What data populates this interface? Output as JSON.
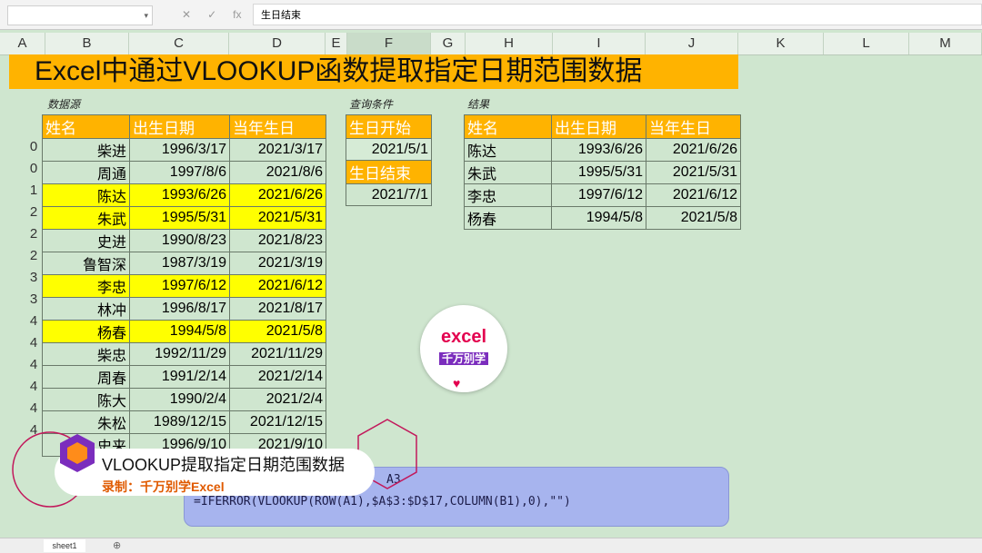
{
  "formula_bar": {
    "name_box": "",
    "fx": "fx",
    "value": "生日结束"
  },
  "columns": [
    "A",
    "B",
    "C",
    "D",
    "E",
    "F",
    "G",
    "H",
    "I",
    "J",
    "K",
    "L",
    "M"
  ],
  "title": "Excel中通过VLOOKUP函数提取指定日期范围数据",
  "source": {
    "label": "数据源",
    "headers": [
      "姓名",
      "出生日期",
      "当年生日"
    ],
    "rows": [
      {
        "a": "0",
        "name": "柴进",
        "birth": "1996/3/17",
        "bday": "2021/3/17"
      },
      {
        "a": "0",
        "name": "周通",
        "birth": "1997/8/6",
        "bday": "2021/8/6"
      },
      {
        "a": "1",
        "name": "陈达",
        "birth": "1993/6/26",
        "bday": "2021/6/26"
      },
      {
        "a": "2",
        "name": "朱武",
        "birth": "1995/5/31",
        "bday": "2021/5/31"
      },
      {
        "a": "2",
        "name": "史进",
        "birth": "1990/8/23",
        "bday": "2021/8/23"
      },
      {
        "a": "2",
        "name": "鲁智深",
        "birth": "1987/3/19",
        "bday": "2021/3/19"
      },
      {
        "a": "3",
        "name": "李忠",
        "birth": "1997/6/12",
        "bday": "2021/6/12"
      },
      {
        "a": "3",
        "name": "林冲",
        "birth": "1996/8/17",
        "bday": "2021/8/17"
      },
      {
        "a": "4",
        "name": "杨春",
        "birth": "1994/5/8",
        "bday": "2021/5/8"
      },
      {
        "a": "4",
        "name": "柴忠",
        "birth": "1992/11/29",
        "bday": "2021/11/29"
      },
      {
        "a": "4",
        "name": "周春",
        "birth": "1991/2/14",
        "bday": "2021/2/14"
      },
      {
        "a": "4",
        "name": "陈大",
        "birth": "1990/2/4",
        "bday": "2021/2/4"
      },
      {
        "a": "4",
        "name": "朱松",
        "birth": "1989/12/15",
        "bday": "2021/12/15"
      },
      {
        "a": "4",
        "name": "史来",
        "birth": "1996/9/10",
        "bday": "2021/9/10"
      }
    ]
  },
  "criteria": {
    "label": "查询条件",
    "start_label": "生日开始",
    "start_value": "2021/5/1",
    "end_label": "生日结束",
    "end_value": "2021/7/1"
  },
  "result": {
    "label": "结果",
    "headers": [
      "姓名",
      "出生日期",
      "当年生日"
    ],
    "rows": [
      {
        "name": "陈达",
        "birth": "1993/6/26",
        "bday": "2021/6/26"
      },
      {
        "name": "朱武",
        "birth": "1995/5/31",
        "bday": "2021/5/31"
      },
      {
        "name": "李忠",
        "birth": "1997/6/12",
        "bday": "2021/6/12"
      },
      {
        "name": "杨春",
        "birth": "1994/5/8",
        "bday": "2021/5/8"
      }
    ]
  },
  "formula_box": {
    "line1": "A3",
    "line2": "=IFERROR(VLOOKUP(ROW(A1),$A$3:$D$17,COLUMN(B1),0),\"\")"
  },
  "caption": {
    "line1": "VLOOKUP提取指定日期范围数据",
    "line2": "录制：千万别学Excel"
  },
  "logo": {
    "line1": "excel",
    "line2": "千万别学"
  },
  "sheet_tab": "sheet1",
  "colors": {
    "header_orange": "#ffb300",
    "highlight": "#ffff00",
    "grid_bg": "#cfe6cf"
  }
}
